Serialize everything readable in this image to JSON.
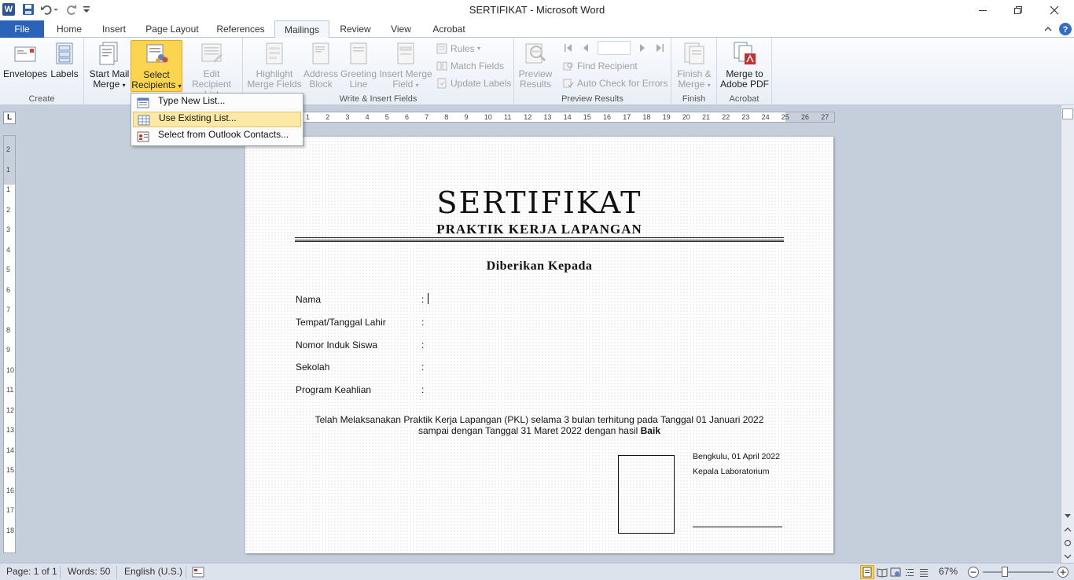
{
  "window": {
    "title": "SERTIFIKAT  -  Microsoft Word",
    "app_logo": "W"
  },
  "tabs": [
    {
      "label": "File"
    },
    {
      "label": "Home"
    },
    {
      "label": "Insert"
    },
    {
      "label": "Page Layout"
    },
    {
      "label": "References"
    },
    {
      "label": "Mailings"
    },
    {
      "label": "Review"
    },
    {
      "label": "View"
    },
    {
      "label": "Acrobat"
    }
  ],
  "ribbon": {
    "create": {
      "label": "Create",
      "envelopes": "Envelopes",
      "labels": "Labels"
    },
    "start_mail_merge": {
      "label": "Start Mail Merge",
      "start_line1": "Start Mail",
      "start_line2": "Merge",
      "select_line1": "Select",
      "select_line2": "Recipients",
      "edit_line1": "Edit",
      "edit_line2": "Recipient List"
    },
    "write_insert": {
      "label": "Write & Insert Fields",
      "highlight_line1": "Highlight",
      "highlight_line2": "Merge Fields",
      "address_line1": "Address",
      "address_line2": "Block",
      "greeting_line1": "Greeting",
      "greeting_line2": "Line",
      "insert_line1": "Insert Merge",
      "insert_line2": "Field",
      "rules": "Rules",
      "match_fields": "Match Fields",
      "update_labels": "Update Labels"
    },
    "preview": {
      "label": "Preview Results",
      "preview_line1": "Preview",
      "preview_line2": "Results",
      "find_recipient": "Find Recipient",
      "auto_check": "Auto Check for Errors"
    },
    "finish": {
      "label": "Finish",
      "finish_line1": "Finish &",
      "finish_line2": "Merge"
    },
    "acrobat": {
      "label": "Acrobat",
      "merge_line1": "Merge to",
      "merge_line2": "Adobe PDF"
    }
  },
  "dropdown": {
    "items": [
      {
        "label": "Type New List..."
      },
      {
        "label": "Use Existing List..."
      },
      {
        "label": "Select from Outlook Contacts..."
      }
    ]
  },
  "ruler": {
    "horizontal_ticks": [
      "1",
      "2",
      "3",
      "4",
      "5",
      "6",
      "7",
      "8",
      "9",
      "10",
      "11",
      "12",
      "13",
      "14",
      "15",
      "16",
      "17",
      "18",
      "19",
      "20",
      "21",
      "22",
      "23",
      "24",
      "25",
      "26",
      "27"
    ],
    "vertical_ticks": [
      "2",
      "1",
      "1",
      "2",
      "3",
      "4",
      "5",
      "6",
      "7",
      "8",
      "9",
      "10",
      "11",
      "12",
      "13",
      "14",
      "15",
      "16",
      "17",
      "18"
    ],
    "corner": "L"
  },
  "document": {
    "title": "SERTIFIKAT",
    "subtitle": "PRAKTIK KERJA LAPANGAN",
    "given_to": "Diberikan Kepada",
    "fields": [
      {
        "label": "Nama",
        "colon": ":"
      },
      {
        "label": "Tempat/Tanggal Lahir",
        "colon": ":"
      },
      {
        "label": "Nomor Induk Siswa",
        "colon": ":"
      },
      {
        "label": "Sekolah",
        "colon": ":"
      },
      {
        "label": "Program Keahlian",
        "colon": ":"
      }
    ],
    "statement_line1": "Telah Melaksanakan Praktik Kerja Lapangan (PKL) selama 3 bulan terhitung pada Tanggal 01 Januari 2022",
    "statement_line2_prefix": "sampai dengan Tanggal 31 Maret 2022 dengan hasil ",
    "statement_line2_bold": "Baik",
    "place_date": "Bengkulu, 01 April 2022",
    "signer_title": "Kepala Laboratorium"
  },
  "status": {
    "page": "Page: 1 of 1",
    "words": "Words: 50",
    "language": "English (U.S.)",
    "zoom": "67%"
  },
  "icons": {
    "save": "save-icon",
    "undo": "undo-icon",
    "redo": "redo-icon",
    "help": "help-icon"
  },
  "colors": {
    "file_tab": "#2a63b8",
    "selected_button": "#fbd54f",
    "dropdown_highlight": "#fce9a6"
  }
}
